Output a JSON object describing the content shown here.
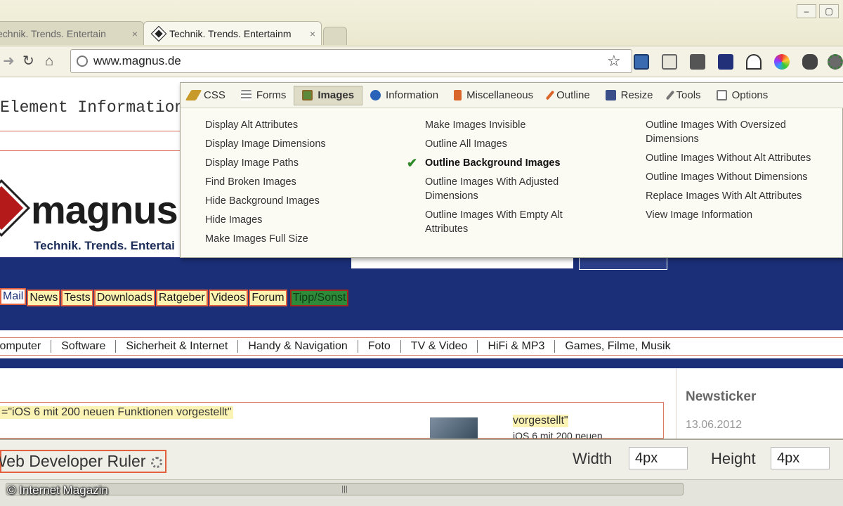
{
  "browser": {
    "tabs": [
      {
        "title": "Technik. Trends. Entertain",
        "close": "×"
      },
      {
        "title": "Technik. Trends. Entertainm",
        "close": "×"
      }
    ],
    "window_buttons": [
      "–",
      "▢"
    ],
    "address": "www.magnus.de",
    "nav_icons": {
      "back": "back-arrow-icon",
      "reload": "reload-icon",
      "home": "home-icon"
    }
  },
  "developer_menu": {
    "tabs": [
      {
        "label": "CSS",
        "icon": "pencil-icon",
        "color": "#c79a2a"
      },
      {
        "label": "Forms",
        "icon": "form-icon",
        "color": "#8a8a8a"
      },
      {
        "label": "Images",
        "icon": "image-icon",
        "color": "#5d8a3a",
        "active": true
      },
      {
        "label": "Information",
        "icon": "info-icon",
        "color": "#2a63b8"
      },
      {
        "label": "Miscellaneous",
        "icon": "misc-icon",
        "color": "#d9652a"
      },
      {
        "label": "Outline",
        "icon": "outline-pencil-icon",
        "color": "#d9652a"
      },
      {
        "label": "Resize",
        "icon": "resize-icon",
        "color": "#3a4f8a"
      },
      {
        "label": "Tools",
        "icon": "wrench-icon",
        "color": "#777777"
      },
      {
        "label": "Options",
        "icon": "options-icon",
        "color": "#777777"
      }
    ],
    "columns": [
      [
        {
          "label": "Display Alt Attributes"
        },
        {
          "label": "Display Image Dimensions"
        },
        {
          "label": "Display Image Paths"
        },
        {
          "label": "Find Broken Images"
        },
        {
          "label": "Hide Background Images"
        },
        {
          "label": "Hide Images"
        },
        {
          "label": "Make Images Full Size"
        }
      ],
      [
        {
          "label": "Make Images Invisible"
        },
        {
          "label": "Outline All Images"
        },
        {
          "label": "Outline Background Images",
          "checked": true
        },
        {
          "label": "Outline Images With Adjusted Dimensions"
        },
        {
          "label": "Outline Images With Empty Alt Attributes"
        }
      ],
      [
        {
          "label": "Outline Images With Oversized Dimensions"
        },
        {
          "label": "Outline Images Without Alt Attributes"
        },
        {
          "label": "Outline Images Without Dimensions"
        },
        {
          "label": "Replace Images With Alt Attributes"
        },
        {
          "label": "View Image Information"
        }
      ]
    ]
  },
  "page": {
    "element_info": "Element Information",
    "logo": {
      "text": "magnus.",
      "tagline": "Technik. Trends. Entertai"
    },
    "nav_links": [
      "Mail",
      "News",
      "Tests",
      "Downloads",
      "Ratgeber",
      "Videos",
      "Forum",
      "Tipp/Sonst"
    ],
    "categories": [
      "Computer",
      "Software",
      "Sicherheit & Internet",
      "Handy & Navigation",
      "Foto",
      "TV & Video",
      "HiFi & MP3",
      "Games, Filme, Musik"
    ],
    "article_alt": "=\"iOS 6 mit 200 neuen Funktionen vorgestellt\"",
    "article_teaser": "vorgestellt\"",
    "article_sub": "iOS 6 mit 200 neuen",
    "sidebar": {
      "title": "Newsticker",
      "date": "13.06.2012"
    }
  },
  "ruler": {
    "title": "Web Developer Ruler",
    "width_label": "Width",
    "width_value": "4px",
    "height_label": "Height",
    "height_value": "4px"
  },
  "scrollbar": {
    "grip": "|||"
  },
  "credit": "© Internet Magazin"
}
